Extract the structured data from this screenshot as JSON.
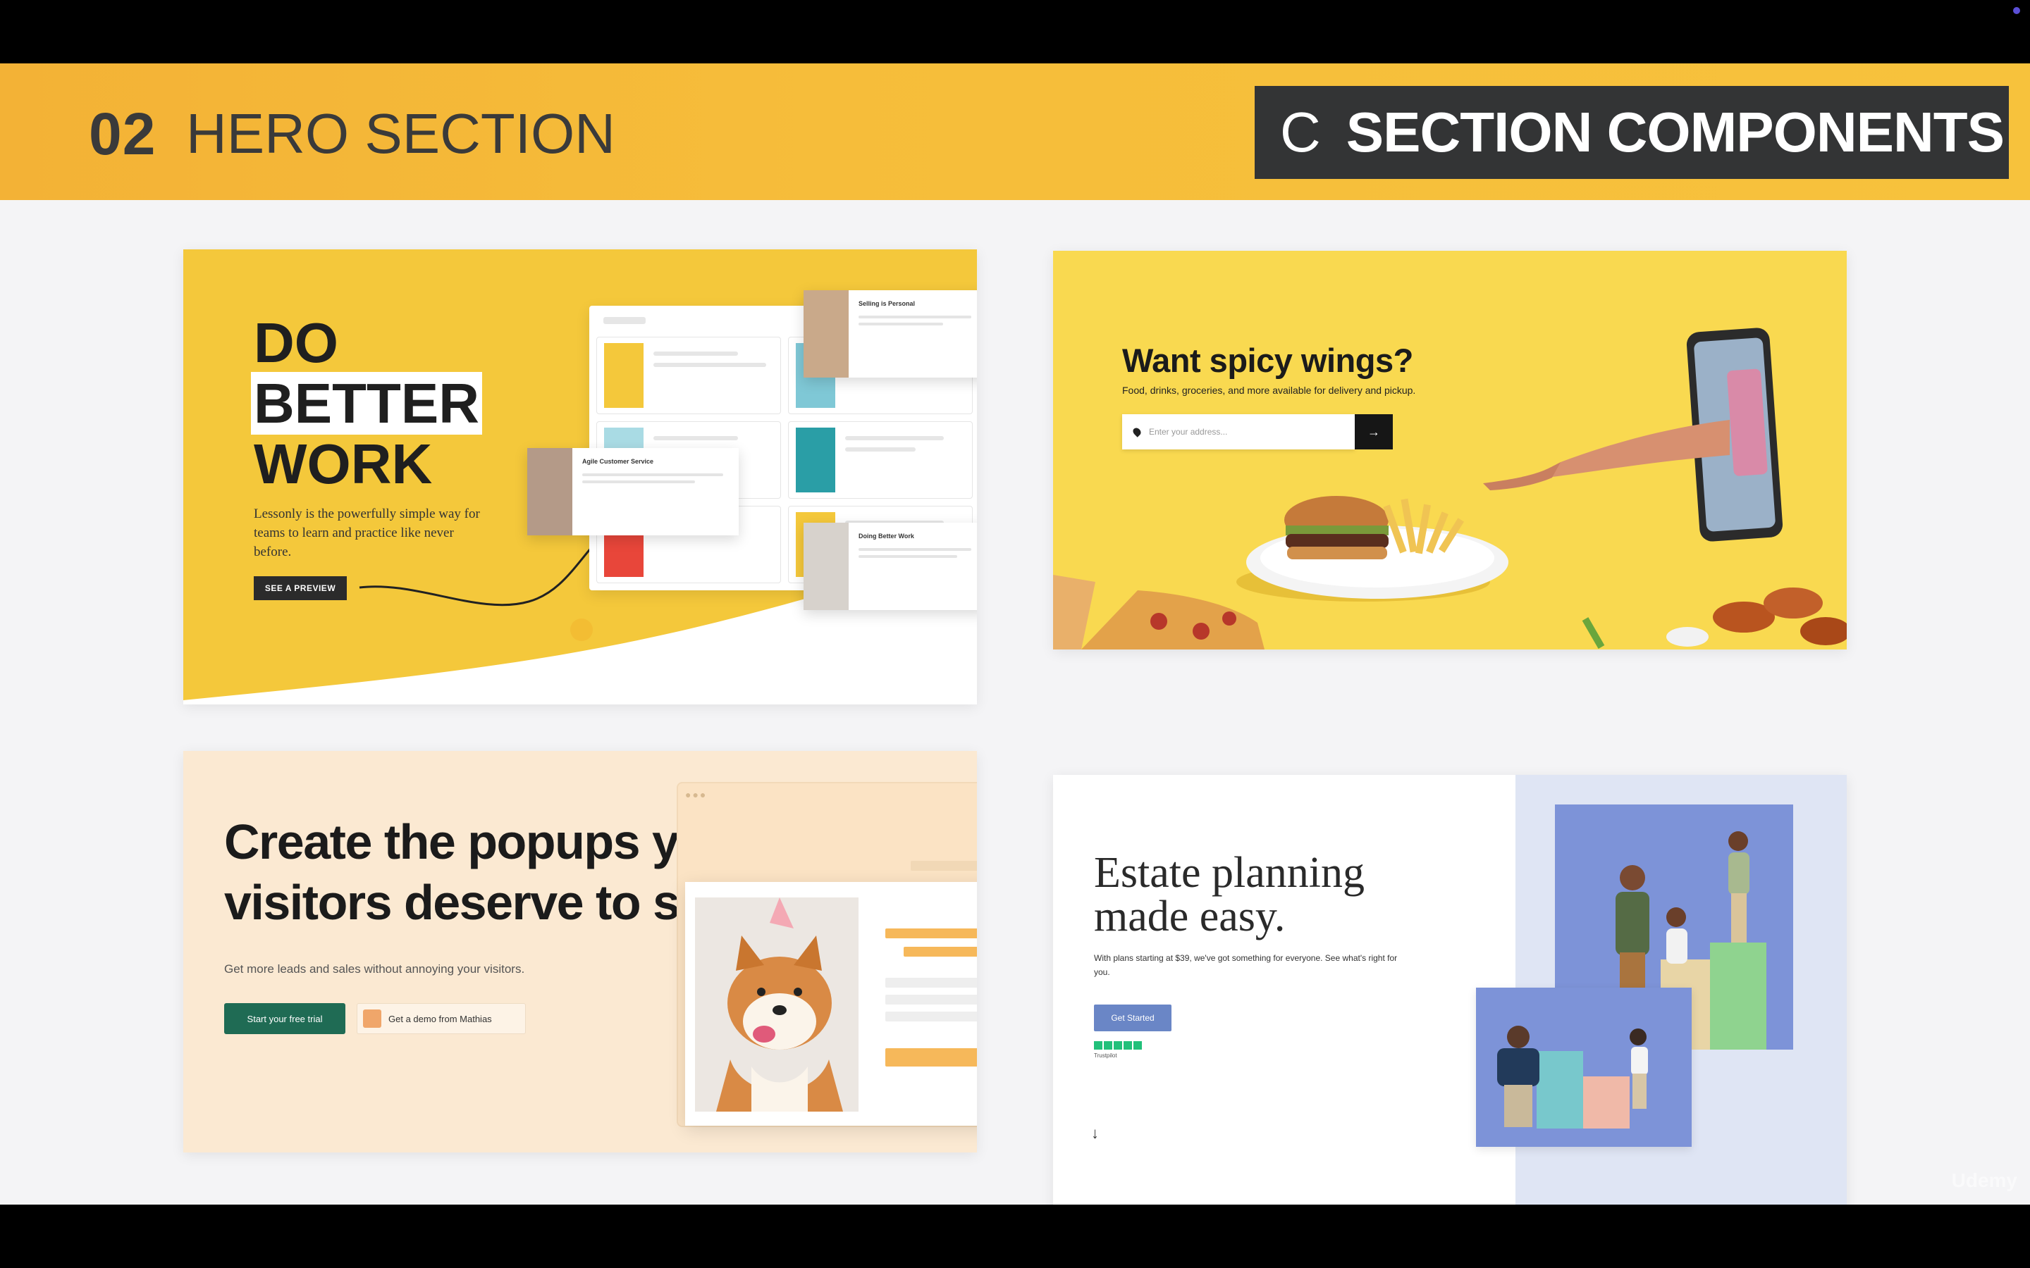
{
  "header": {
    "section_number": "02",
    "section_title": "HERO SECTION",
    "badge_letter": "C",
    "badge_text": "SECTION COMPONENTS"
  },
  "examples": {
    "lessonly": {
      "headline_line1": "DO",
      "headline_line2": "BETTER",
      "headline_line3": "WORK",
      "subtext": "Lessonly is the powerfully simple way for teams to learn and practice like never before.",
      "cta": "SEE A PREVIEW",
      "card_top_title": "Selling is Personal",
      "card_mid_title": "Agile Customer Service",
      "card_bottom_title": "Doing Better Work",
      "accent": "#f4c83b"
    },
    "doordash": {
      "headline": "Want spicy wings?",
      "subtext": "Food, drinks, groceries, and more available for delivery and pickup.",
      "input_placeholder": "Enter your address...",
      "go_icon": "arrow-right-icon",
      "pin_icon": "location-pin-icon",
      "accent": "#f9d950"
    },
    "popup": {
      "headline_line1": "Create the popups your",
      "headline_line2": "visitors deserve to see",
      "subtext": "Get more leads and sales without annoying your visitors.",
      "cta_primary": "Start your free trial",
      "cta_secondary": "Get a demo from Mathias",
      "accent": "#1f6b54"
    },
    "estate": {
      "headline_line1": "Estate planning",
      "headline_line2": "made easy.",
      "subtext": "With plans starting at $39, we've got something for everyone. See what's right for you.",
      "cta": "Get Started",
      "rating_label": "Trustpilot",
      "scroll_arrow": "↓",
      "accent": "#6a86c6"
    }
  },
  "watermark": "Udemy"
}
